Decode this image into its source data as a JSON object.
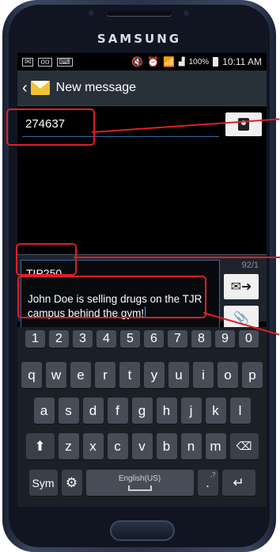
{
  "device": {
    "brand": "SAMSUNG"
  },
  "statusbar": {
    "left_icons": [
      "email-icon",
      "voicemail-icon",
      "keyboard-icon"
    ],
    "right_icons": [
      "mute-icon",
      "alarm-icon",
      "wifi-icon",
      "signal-icon"
    ],
    "battery_percent": "100%",
    "time": "10:11 AM"
  },
  "titlebar": {
    "back_icon": "chevron-left-icon",
    "app_icon": "envelope-icon",
    "title": "New message"
  },
  "recipient": {
    "value": "274637",
    "contact_icon": "contact-picker-icon"
  },
  "compose": {
    "subject": "TIP250",
    "counter": "92/1",
    "body": "John Doe is selling drugs on the TJR campus behind the gym!",
    "send_icon": "send-message-icon",
    "attach_icon": "paperclip-icon"
  },
  "keyboard": {
    "number_row": [
      "1",
      "2",
      "3",
      "4",
      "5",
      "6",
      "7",
      "8",
      "9",
      "0"
    ],
    "row1": [
      "q",
      "w",
      "e",
      "r",
      "t",
      "y",
      "u",
      "i",
      "o",
      "p"
    ],
    "row2": [
      "a",
      "s",
      "d",
      "f",
      "g",
      "h",
      "j",
      "k",
      "l"
    ],
    "row3": [
      "z",
      "x",
      "c",
      "v",
      "b",
      "n",
      "m"
    ],
    "sym_label": "Sym",
    "space_label": "English(US)",
    "period_label": ".",
    "period_sup": ",?",
    "shift_icon": "shift-arrow-icon",
    "backspace_icon": "backspace-icon",
    "settings_icon": "gear-icon",
    "enter_icon": "enter-arrow-icon"
  },
  "colors": {
    "annotation": "#e01e26",
    "accent": "#4a9de8"
  }
}
